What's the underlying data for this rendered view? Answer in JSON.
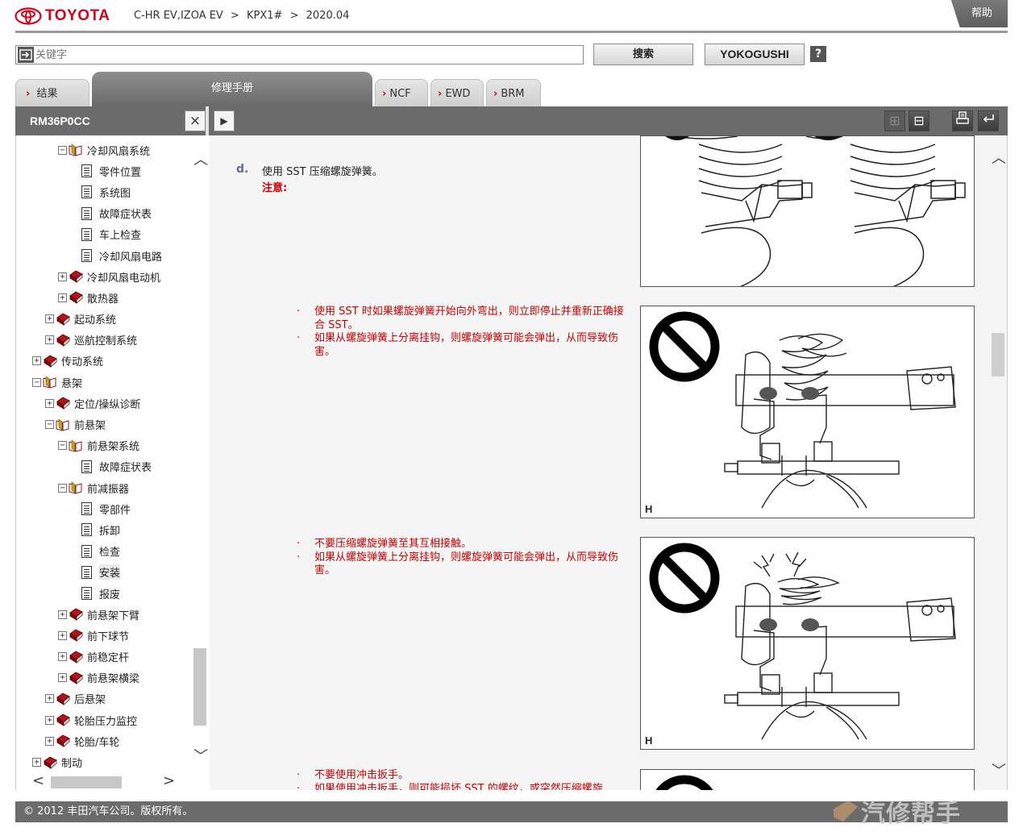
{
  "header": {
    "brand": "TOYOTA",
    "breadcrumb": [
      "C-HR EV,IZOA EV",
      ">",
      "KPX1#",
      ">",
      "2020.04"
    ],
    "help_label": "帮助"
  },
  "search": {
    "placeholder": "关键字",
    "value": "",
    "search_button": "搜索",
    "yokogushi_button": "YOKOGUSHI",
    "help_icon_label": "?"
  },
  "tabs": [
    {
      "label": "结果",
      "active": false
    },
    {
      "label": "修理手册",
      "active": true
    },
    {
      "label": "NCF",
      "active": false
    },
    {
      "label": "EWD",
      "active": false
    },
    {
      "label": "BRM",
      "active": false
    }
  ],
  "toolbar": {
    "doc_id": "RM36P0CC",
    "close_icon": "×",
    "play_icon": "▶",
    "expand_icon": "⊞",
    "collapse_icon": "⊟",
    "print_icon": "print-icon",
    "back_icon": "back-icon"
  },
  "tree": [
    {
      "label": "冷却风扇系统",
      "level": 3,
      "type": "open-book",
      "toggle": "−"
    },
    {
      "label": "零件位置",
      "level": 4,
      "type": "doc",
      "toggle": ""
    },
    {
      "label": "系统图",
      "level": 4,
      "type": "doc",
      "toggle": ""
    },
    {
      "label": "故障症状表",
      "level": 4,
      "type": "doc",
      "toggle": ""
    },
    {
      "label": "车上检查",
      "level": 4,
      "type": "doc",
      "toggle": ""
    },
    {
      "label": "冷却风扇电路",
      "level": 4,
      "type": "doc",
      "toggle": ""
    },
    {
      "label": "冷却风扇电动机",
      "level": 3,
      "type": "book",
      "toggle": "+"
    },
    {
      "label": "散热器",
      "level": 3,
      "type": "book",
      "toggle": "+"
    },
    {
      "label": "起动系统",
      "level": 2,
      "type": "book",
      "toggle": "+"
    },
    {
      "label": "巡航控制系统",
      "level": 2,
      "type": "book",
      "toggle": "+"
    },
    {
      "label": "传动系统",
      "level": 1,
      "type": "book",
      "toggle": "+"
    },
    {
      "label": "悬架",
      "level": 1,
      "type": "open-book",
      "toggle": "−"
    },
    {
      "label": "定位/操纵诊断",
      "level": 2,
      "type": "book",
      "toggle": "+"
    },
    {
      "label": "前悬架",
      "level": 2,
      "type": "open-book",
      "toggle": "−"
    },
    {
      "label": "前悬架系统",
      "level": 3,
      "type": "open-book",
      "toggle": "−"
    },
    {
      "label": "故障症状表",
      "level": 4,
      "type": "doc",
      "toggle": ""
    },
    {
      "label": "前减振器",
      "level": 3,
      "type": "open-book",
      "toggle": "−"
    },
    {
      "label": "零部件",
      "level": 4,
      "type": "doc",
      "toggle": ""
    },
    {
      "label": "拆卸",
      "level": 4,
      "type": "doc",
      "toggle": ""
    },
    {
      "label": "检查",
      "level": 4,
      "type": "doc",
      "toggle": ""
    },
    {
      "label": "安装",
      "level": 4,
      "type": "doc",
      "toggle": "",
      "selected": true
    },
    {
      "label": "报废",
      "level": 4,
      "type": "doc",
      "toggle": ""
    },
    {
      "label": "前悬架下臂",
      "level": 3,
      "type": "book",
      "toggle": "+"
    },
    {
      "label": "前下球节",
      "level": 3,
      "type": "book",
      "toggle": "+"
    },
    {
      "label": "前稳定杆",
      "level": 3,
      "type": "book",
      "toggle": "+"
    },
    {
      "label": "前悬架横梁",
      "level": 3,
      "type": "book",
      "toggle": "+"
    },
    {
      "label": "后悬架",
      "level": 2,
      "type": "book",
      "toggle": "+"
    },
    {
      "label": "轮胎压力监控",
      "level": 2,
      "type": "book",
      "toggle": "+"
    },
    {
      "label": "轮胎/车轮",
      "level": 2,
      "type": "book",
      "toggle": "+"
    },
    {
      "label": "制动",
      "level": 1,
      "type": "book",
      "toggle": "+"
    }
  ],
  "content": {
    "step_letter": "d.",
    "step_text": "使用 SST 压缩螺旋弹簧。",
    "step_note": "注意:",
    "warnings_1": [
      "使用 SST 时如果螺旋弹簧开始向外弯出，则立即停止并重新正确接合 SST。",
      "如果从螺旋弹簧上分离挂钩，则螺旋弹簧可能会弹出，从而导致伤害。"
    ],
    "warnings_2": [
      "不要压缩螺旋弹簧至其互相接触。",
      "如果从螺旋弹簧上分离挂钩，则螺旋弹簧可能会弹出，从而导致伤害。"
    ],
    "warnings_3": [
      "不要使用冲击扳手。",
      "如果使用冲击扳手，则可能损坏 SST 的螺纹，或突然压缩螺旋"
    ],
    "figure_labels": [
      "H",
      "H"
    ]
  },
  "footer": {
    "copyright": "© 2012 丰田汽车公司。版权所有。",
    "watermark": "汽修帮手"
  },
  "colors": {
    "brand_red": "#d0021b",
    "warning_red": "#cc0000",
    "toolbar_gray": "#6b6b6b"
  }
}
